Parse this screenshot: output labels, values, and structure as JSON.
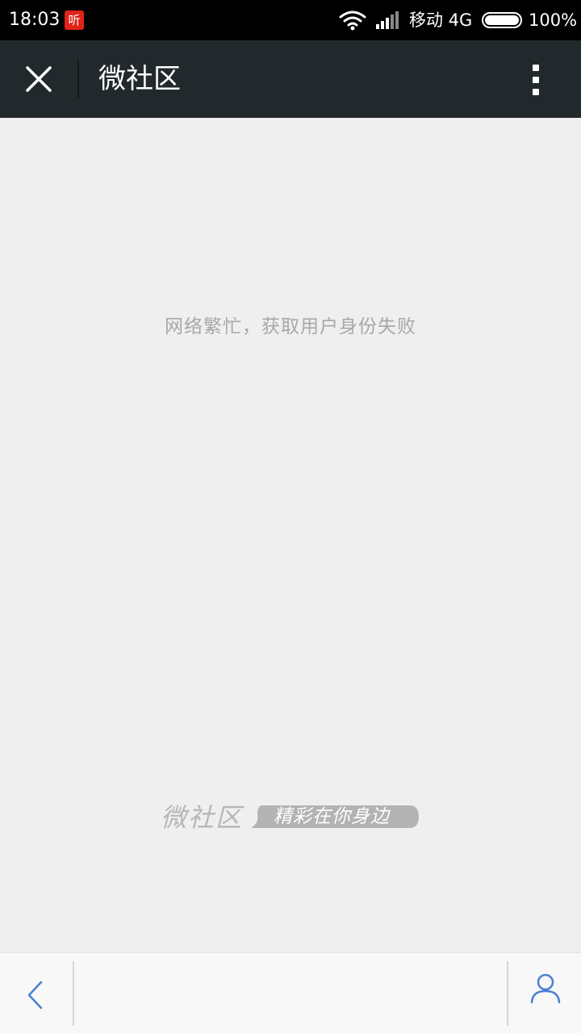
{
  "status_bar": {
    "time": "18:03",
    "app_badge": "听",
    "carrier": "移动 4G",
    "battery": "100%",
    "badge_color": "#e2231a"
  },
  "title_bar": {
    "title": "微社区",
    "close_icon": "close-icon",
    "more_icon": "more-vertical-icon",
    "background_color": "#22292c"
  },
  "content": {
    "error_message": "网络繁忙，获取用户身份失败",
    "brand_name": "微社区",
    "brand_slogan": "精彩在你身边"
  },
  "bottom_bar": {
    "back_icon": "chevron-left-icon",
    "profile_icon": "user-icon",
    "accent_color": "#4a7fd4"
  }
}
